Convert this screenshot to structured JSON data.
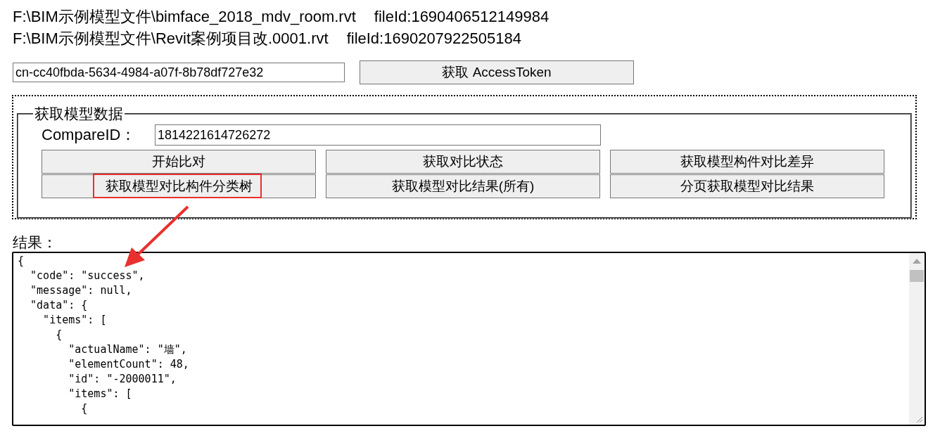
{
  "files": [
    {
      "path": "F:\\BIM示例模型文件\\bimface_2018_mdv_room.rvt",
      "file_id": "fileId:1690406512149984"
    },
    {
      "path": "F:\\BIM示例模型文件\\Revit案例项目改.0001.rvt",
      "file_id": "fileId:1690207922505184"
    }
  ],
  "token": {
    "value": "cn-cc40fbda-5634-4984-a07f-8b78df727e32",
    "button": "获取 AccessToken"
  },
  "model_data": {
    "legend": "获取模型数据",
    "compare_label": "CompareID：",
    "compare_value": "1814221614726272",
    "buttons": [
      {
        "label": "开始比对",
        "highlighted": false
      },
      {
        "label": "获取对比状态",
        "highlighted": false
      },
      {
        "label": "获取模型构件对比差异",
        "highlighted": false
      },
      {
        "label": "获取模型对比构件分类树",
        "highlighted": true
      },
      {
        "label": "获取模型对比结果(所有)",
        "highlighted": false
      },
      {
        "label": "分页获取模型对比结果",
        "highlighted": false
      }
    ]
  },
  "result": {
    "label": "结果：",
    "lines": [
      "{",
      "  \"code\": \"success\",",
      "  \"message\": null,",
      "  \"data\": {",
      "    \"items\": [",
      "      {",
      "        \"actualName\": \"墙\",",
      "        \"elementCount\": 48,",
      "        \"id\": \"-2000011\",",
      "        \"items\": [",
      "          {"
    ]
  }
}
